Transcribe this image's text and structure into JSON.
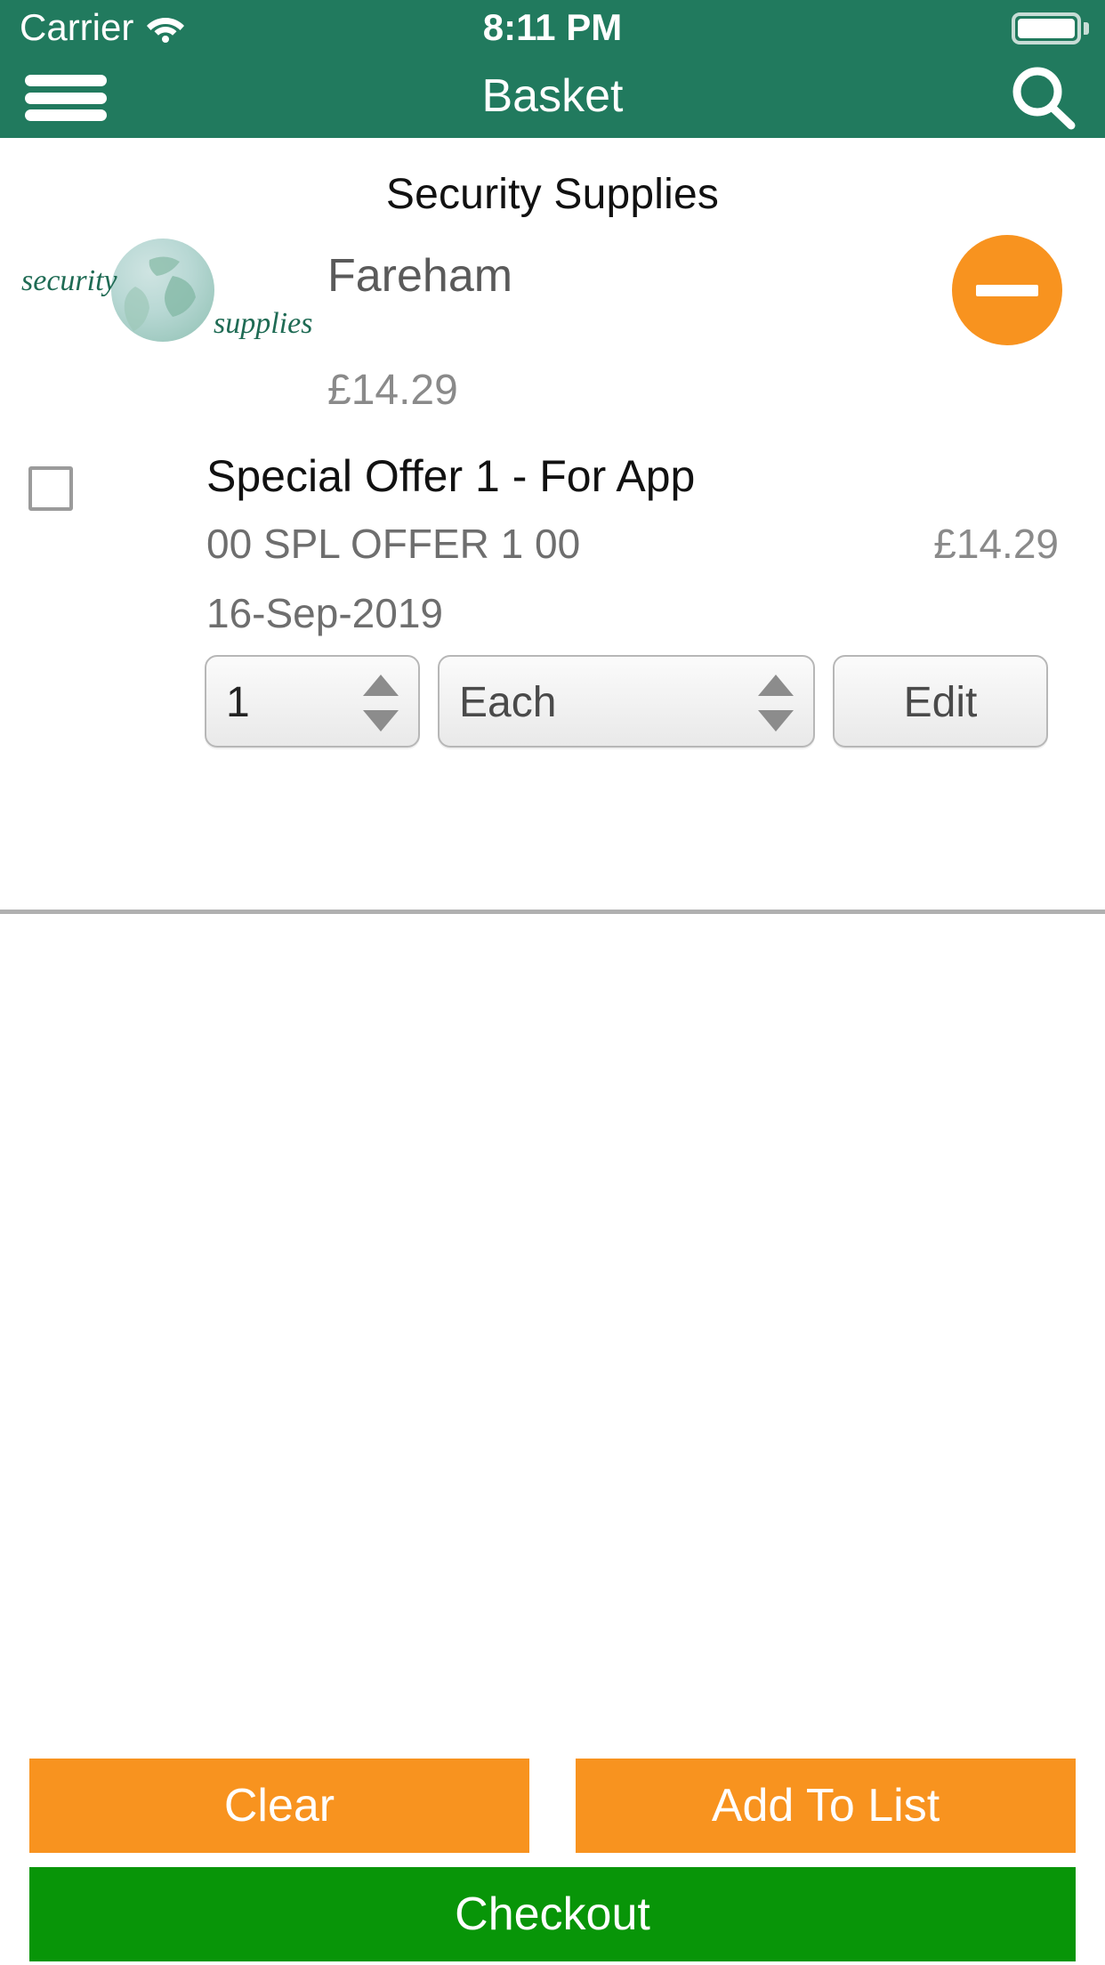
{
  "status_bar": {
    "carrier": "Carrier",
    "wifi_icon": "wifi-icon",
    "time": "8:11 PM",
    "battery_icon": "battery-full-icon"
  },
  "nav_bar": {
    "title": "Basket",
    "menu_icon": "hamburger-menu-icon",
    "search_icon": "search-icon"
  },
  "main": {
    "store_title": "Security Supplies",
    "logo": {
      "word_left": "security",
      "word_right": "supplies",
      "icon": "globe-icon"
    },
    "store_name": "Fareham",
    "store_total": "£14.29",
    "remove_button_label": "remove-store-button",
    "item": {
      "name": "Special Offer 1 - For App",
      "code": "00 SPL OFFER 1 00",
      "price": "£14.29",
      "date": "16-Sep-2019",
      "checked": false,
      "quantity": "1",
      "unit": "Each",
      "edit_label": "Edit"
    }
  },
  "footer": {
    "clear_label": "Clear",
    "add_to_list_label": "Add To List",
    "checkout_label": "Checkout"
  },
  "colors": {
    "header_green": "#217a5e",
    "accent_orange": "#f8931f",
    "checkout_green": "#089508",
    "logo_green": "#1f6b54",
    "muted_text": "#8a8a8a"
  }
}
